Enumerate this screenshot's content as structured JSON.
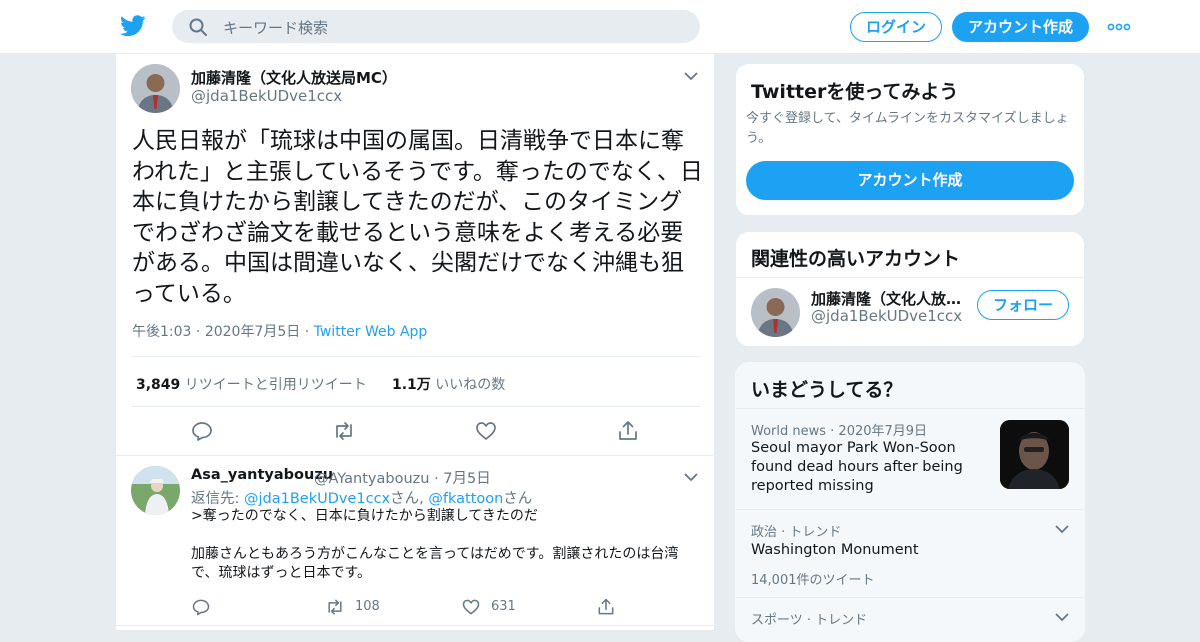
{
  "header": {
    "search_placeholder": "キーワード検索",
    "login_label": "ログイン",
    "signup_label": "アカウント作成"
  },
  "tweet": {
    "name": "加藤清隆（文化人放送局MC）",
    "handle": "@jda1BekUDve1ccx",
    "text": "人民日報が「琉球は中国の属国。日清戦争で日本に奪われた」と主張しているそうです。奪ったのでなく、日本に負けたから割譲してきたのだが、このタイミングでわざわざ論文を載せるという意味をよく考える必要がある。中国は間違いなく、尖閣だけでなく沖縄も狙っている。",
    "time": "午後1:03",
    "date": "2020年7月5日",
    "source": "Twitter Web App",
    "retweet_count": "3,849",
    "retweet_label": "リツイートと引用リツイート",
    "like_count": "1.1万",
    "like_label": "いいねの数"
  },
  "reply": {
    "name": "Asa_yantyabouzu",
    "handle": "@AYantyabouzu",
    "date": "7月5日",
    "reply_to_label": "返信先:",
    "reply_to_1": "@jda1BekUDve1ccx",
    "reply_to_sep": "さん,",
    "reply_to_2": "@fkattoon",
    "reply_to_suffix": "さん",
    "line1": ">奪ったのでなく、日本に負けたから割譲してきたのだ",
    "line2": "加藤さんともあろう方がこんなことを言ってはだめです。割譲されたのは台湾で、琉球はずっと日本です。",
    "retweets": "108",
    "likes": "631"
  },
  "sidebar": {
    "try_title": "Twitterを使ってみよう",
    "try_desc": "今すぐ登録して、タイムラインをカスタマイズしましょう。",
    "try_button": "アカウント作成",
    "related_title": "関連性の高いアカウント",
    "related_name": "加藤清隆（文化人放…",
    "related_handle": "@jda1BekUDve1ccx",
    "follow_label": "フォロー",
    "trends_title": "いまどうしてる？",
    "trends": [
      {
        "category": "World news · 2020年7月9日",
        "title": "Seoul mayor Park Won-Soon found dead hours after being reported missing"
      },
      {
        "category": "政治 · トレンド",
        "title": "Washington Monument",
        "count": "14,001件のツイート"
      },
      {
        "category": "スポーツ · トレンド"
      }
    ]
  },
  "colors": {
    "accent": "#1da1f2",
    "secondary_text": "#657786",
    "border": "#e6ecf0"
  }
}
